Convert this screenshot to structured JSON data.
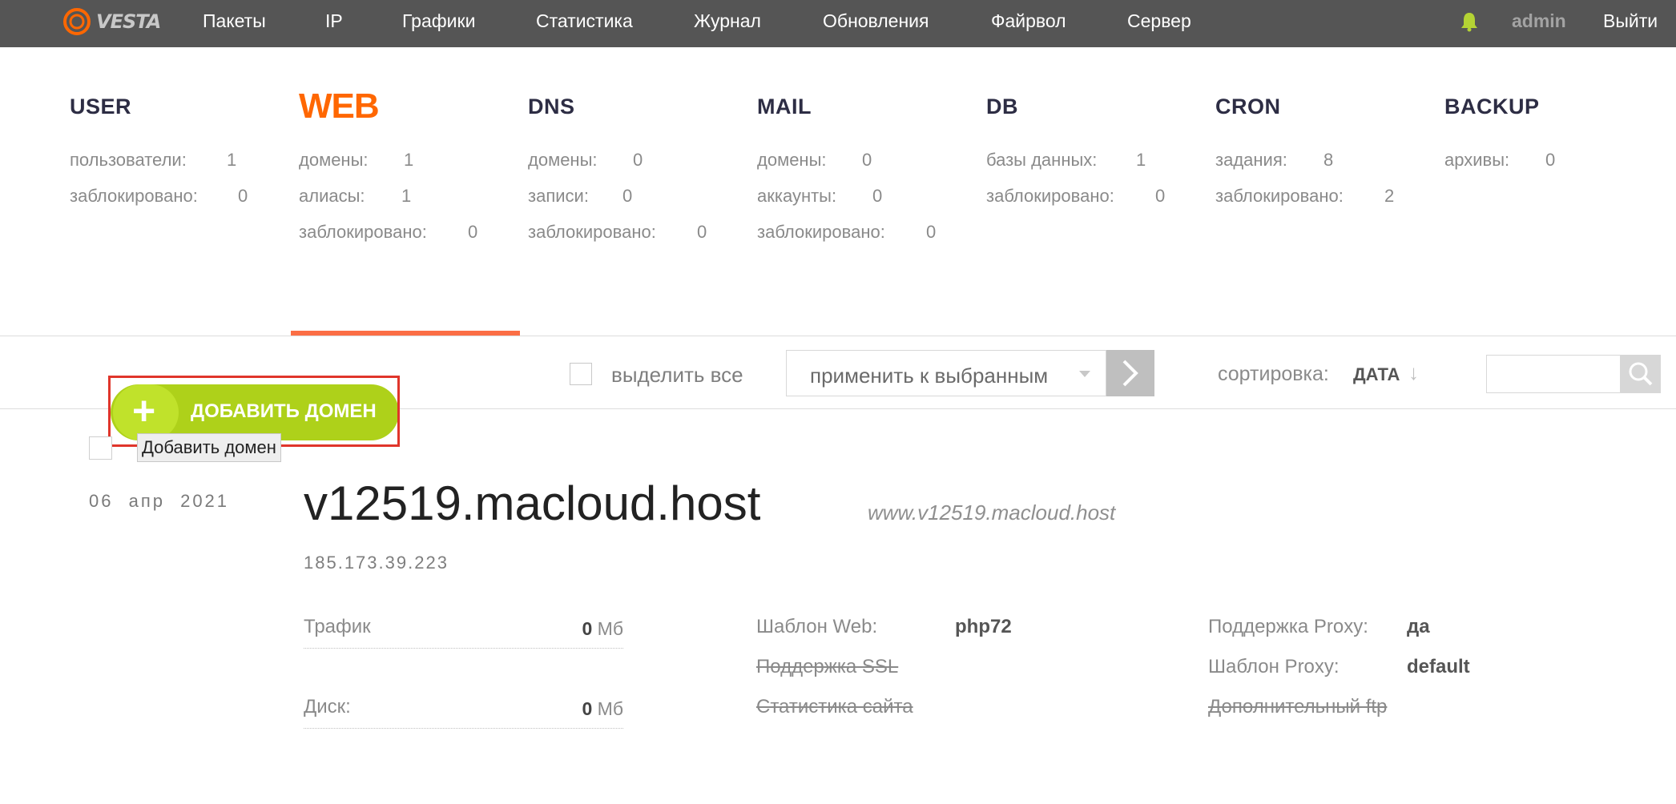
{
  "nav": {
    "logo_text": "VESTA",
    "items": [
      "Пакеты",
      "IP",
      "Графики",
      "Статистика",
      "Журнал",
      "Обновления",
      "Файрвол",
      "Сервер"
    ],
    "user": "admin",
    "logout": "Выйти",
    "colors": {
      "bar": "#555555",
      "accent": "#ff6701",
      "bell": "#b4d334"
    }
  },
  "tabs": [
    {
      "title": "USER",
      "stats": [
        {
          "label": "пользователи:",
          "value": "1"
        },
        {
          "label": "заблокировано:",
          "value": "0"
        }
      ]
    },
    {
      "title": "WEB",
      "active": true,
      "stats": [
        {
          "label": "домены:",
          "value": "1"
        },
        {
          "label": "алиасы:",
          "value": "1"
        },
        {
          "label": "заблокировано:",
          "value": "0"
        }
      ]
    },
    {
      "title": "DNS",
      "stats": [
        {
          "label": "домены:",
          "value": "0"
        },
        {
          "label": "записи:",
          "value": "0"
        },
        {
          "label": "заблокировано:",
          "value": "0"
        }
      ]
    },
    {
      "title": "MAIL",
      "stats": [
        {
          "label": "домены:",
          "value": "0"
        },
        {
          "label": "аккаунты:",
          "value": "0"
        },
        {
          "label": "заблокировано:",
          "value": "0"
        }
      ]
    },
    {
      "title": "DB",
      "stats": [
        {
          "label": "базы данных:",
          "value": "1"
        },
        {
          "label": "заблокировано:",
          "value": "0"
        }
      ]
    },
    {
      "title": "CRON",
      "stats": [
        {
          "label": "задания:",
          "value": "8"
        },
        {
          "label": "заблокировано:",
          "value": "2"
        }
      ]
    },
    {
      "title": "BACKUP",
      "stats": [
        {
          "label": "архивы:",
          "value": "0"
        }
      ]
    }
  ],
  "toolbar": {
    "select_all": "выделить все",
    "apply": "применить к выбранным",
    "sort_label": "сортировка:",
    "sort_value": "ДАТА",
    "sort_arrow": "↓",
    "search_placeholder": ""
  },
  "add_button": {
    "label": "ДОБАВИТЬ ДОМЕН",
    "plus": "+",
    "tooltip": "Добавить домен"
  },
  "domain": {
    "date": "06 апр 2021",
    "name": "v12519.macloud.host",
    "alias": "www.v12519.macloud.host",
    "ip": "185.173.39.223",
    "traffic": {
      "label": "Трафик",
      "value": "0",
      "unit": "Мб"
    },
    "disk": {
      "label": "Диск:",
      "value": "0",
      "unit": "Мб"
    },
    "web_template": {
      "label": "Шаблон Web:",
      "value": "php72"
    },
    "ssl": "Поддержка SSL",
    "stats": "Статистика сайта",
    "proxy": {
      "label": "Поддержка Proxy:",
      "value": "да"
    },
    "proxy_template": {
      "label": "Шаблон Proxy:",
      "value": "default"
    },
    "ftp": "Дополнительный ftp"
  }
}
